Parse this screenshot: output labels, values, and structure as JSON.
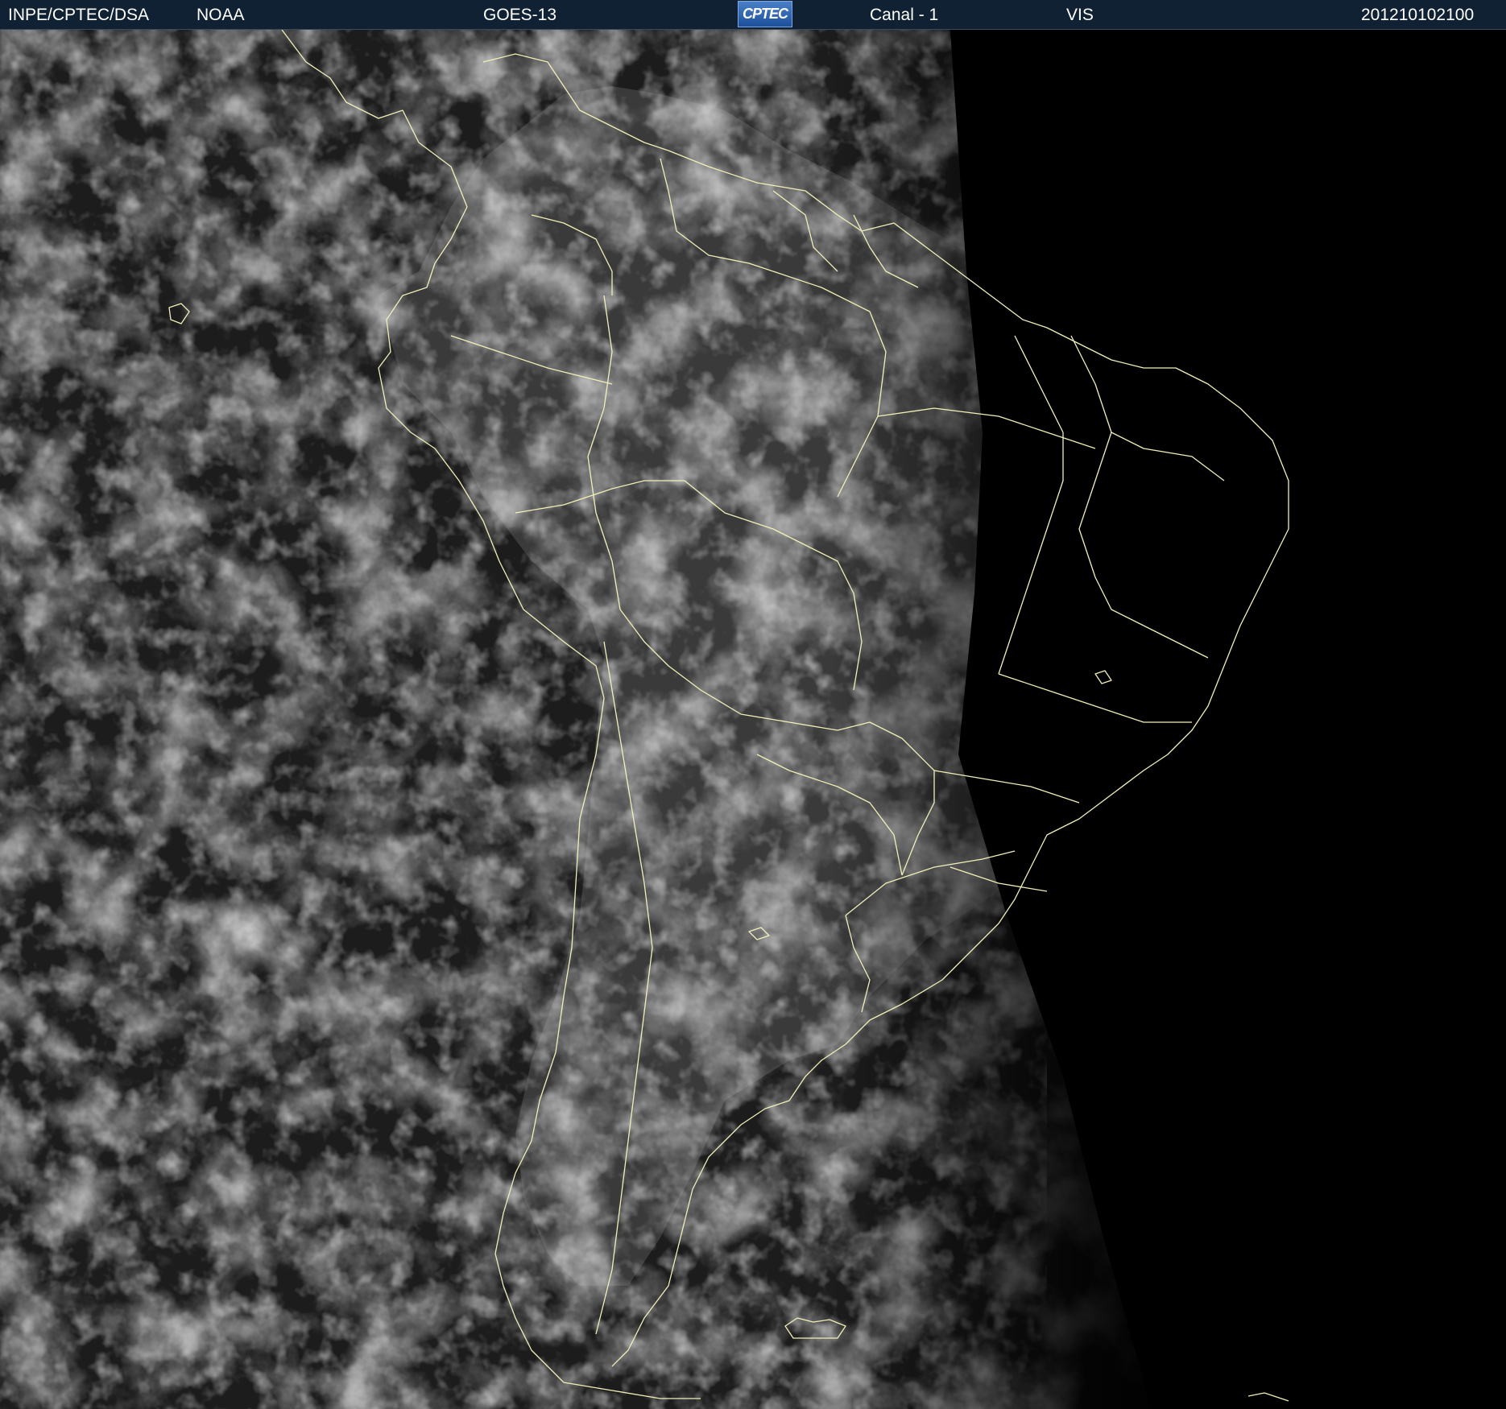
{
  "header": {
    "agency": "INPE/CPTEC/DSA",
    "source": "NOAA",
    "satellite": "GOES-13",
    "logo_text": "CPTEC",
    "channel": "Canal - 1",
    "band": "VIS",
    "timestamp": "201210102100"
  },
  "colors": {
    "header_bg": "#102133",
    "border_lines": "#f2f0b8",
    "space_background": "#000000"
  }
}
